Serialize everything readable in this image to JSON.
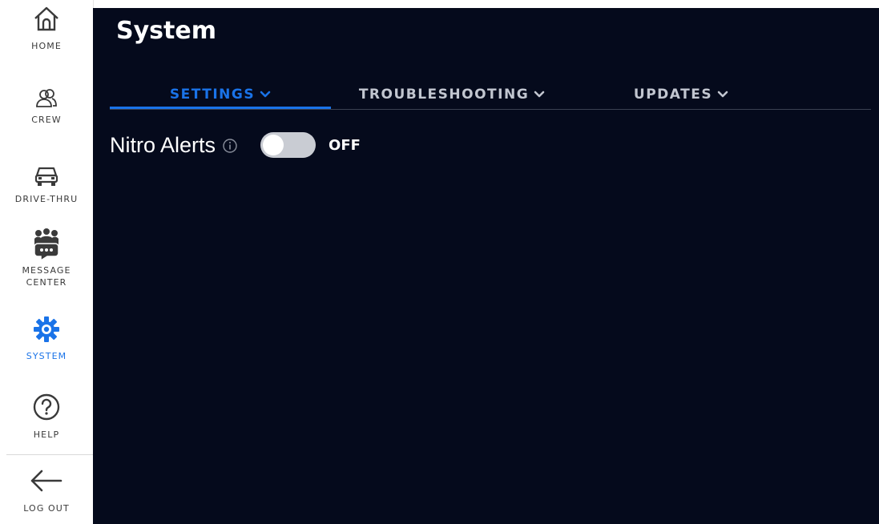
{
  "sidebar": {
    "items": [
      {
        "label": "HOME",
        "icon": "home-icon"
      },
      {
        "label": "CREW",
        "icon": "crew-icon"
      },
      {
        "label": "DRIVE-THRU",
        "icon": "car-icon"
      },
      {
        "label": "MESSAGE\nCENTER",
        "icon": "message-center-icon"
      },
      {
        "label": "SYSTEM",
        "icon": "gear-icon",
        "active": true
      },
      {
        "label": "HELP",
        "icon": "help-icon"
      },
      {
        "label": "LOG OUT",
        "icon": "arrow-left-icon"
      }
    ]
  },
  "main": {
    "title": "System",
    "tabs": [
      {
        "label": "SETTINGS",
        "active": true
      },
      {
        "label": "TROUBLESHOOTING"
      },
      {
        "label": "UPDATES"
      }
    ],
    "settings": {
      "nitro_alerts": {
        "label": "Nitro Alerts",
        "state": "OFF",
        "enabled": false
      }
    }
  },
  "colors": {
    "background": "#050a1c",
    "accent": "#1a73e8",
    "sidebar": "#ffffff",
    "brand_red": "#c8102e"
  }
}
